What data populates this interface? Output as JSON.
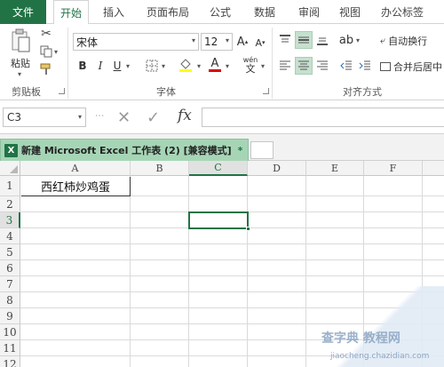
{
  "tabs": {
    "file": "文件",
    "items": [
      "开始",
      "插入",
      "页面布局",
      "公式",
      "数据",
      "审阅",
      "视图",
      "办公标签"
    ]
  },
  "ribbon": {
    "clipboard": {
      "paste": "粘贴",
      "label": "剪贴板"
    },
    "font": {
      "name": "宋体",
      "size": "12",
      "bold": "B",
      "italic": "I",
      "underline": "U",
      "wen": "wén",
      "label": "字体"
    },
    "alignment": {
      "wrap_text": "自动换行",
      "merge_center": "合并后居中",
      "label": "对齐方式"
    }
  },
  "formula_bar": {
    "name_box": "C3",
    "fx": "fx",
    "formula": ""
  },
  "document_tab": {
    "title": "新建 Microsoft Excel 工作表 (2)  [兼容模式]",
    "close": "*"
  },
  "sheet": {
    "columns": [
      "A",
      "B",
      "C",
      "D",
      "E",
      "F"
    ],
    "rows": [
      "1",
      "2",
      "3",
      "4",
      "5",
      "6",
      "7",
      "8",
      "9",
      "10",
      "11",
      "12"
    ],
    "cell_a1": "西红柿炒鸡蛋",
    "selected_cell": "C3"
  },
  "watermark": {
    "line1": "查字典 教程网",
    "line2": "jiaocheng.chazidian.com"
  },
  "colors": {
    "accent": "#217346",
    "doc_tab": "#a6d5b6",
    "selection_fill": "#c6e0cf"
  }
}
